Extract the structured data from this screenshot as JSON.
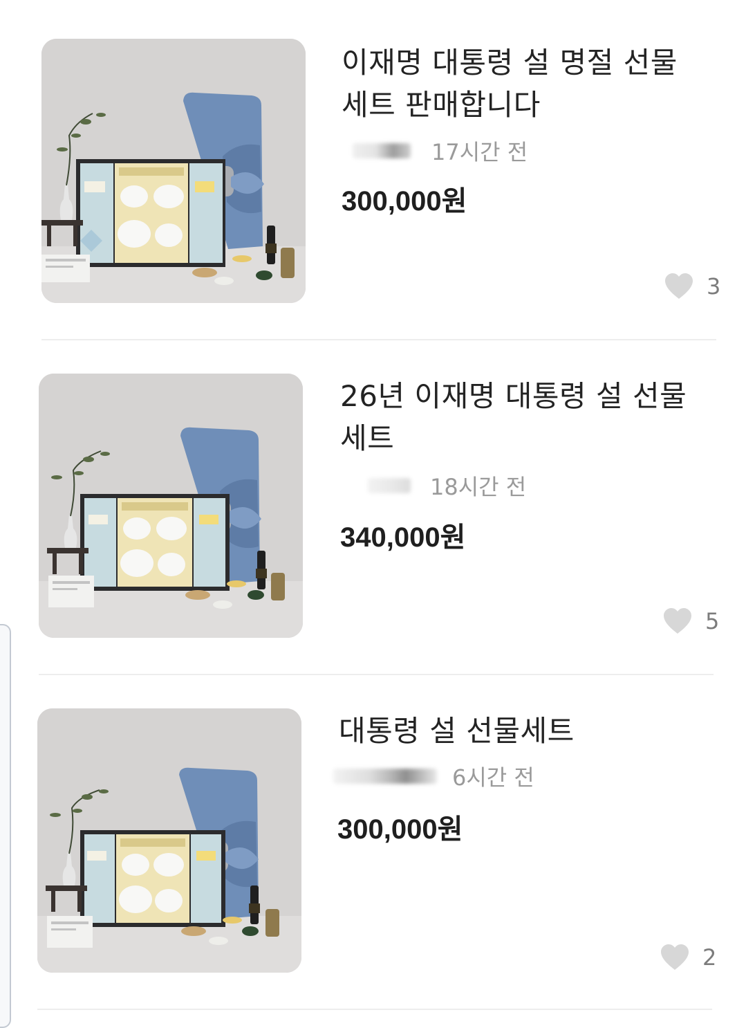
{
  "items": [
    {
      "title": "이재명 대통령 설 명절 선물 세트 판매합니다",
      "time": "17시간 전",
      "price": "300,000원",
      "likes": "3"
    },
    {
      "title": "26년 이재명 대통령 설 선물 세트",
      "time": "18시간 전",
      "price": "340,000원",
      "likes": "5"
    },
    {
      "title": "대통령 설 선물세트",
      "time": "6시간 전",
      "price": "300,000원",
      "likes": "2"
    }
  ],
  "colors": {
    "background": "#ffffff",
    "title_text": "#232323",
    "meta_text": "#9a9a9a",
    "heart": "#d7d7d7",
    "wrap_cloth": "#6f8eb8"
  },
  "icons": {
    "like": "heart-icon"
  }
}
